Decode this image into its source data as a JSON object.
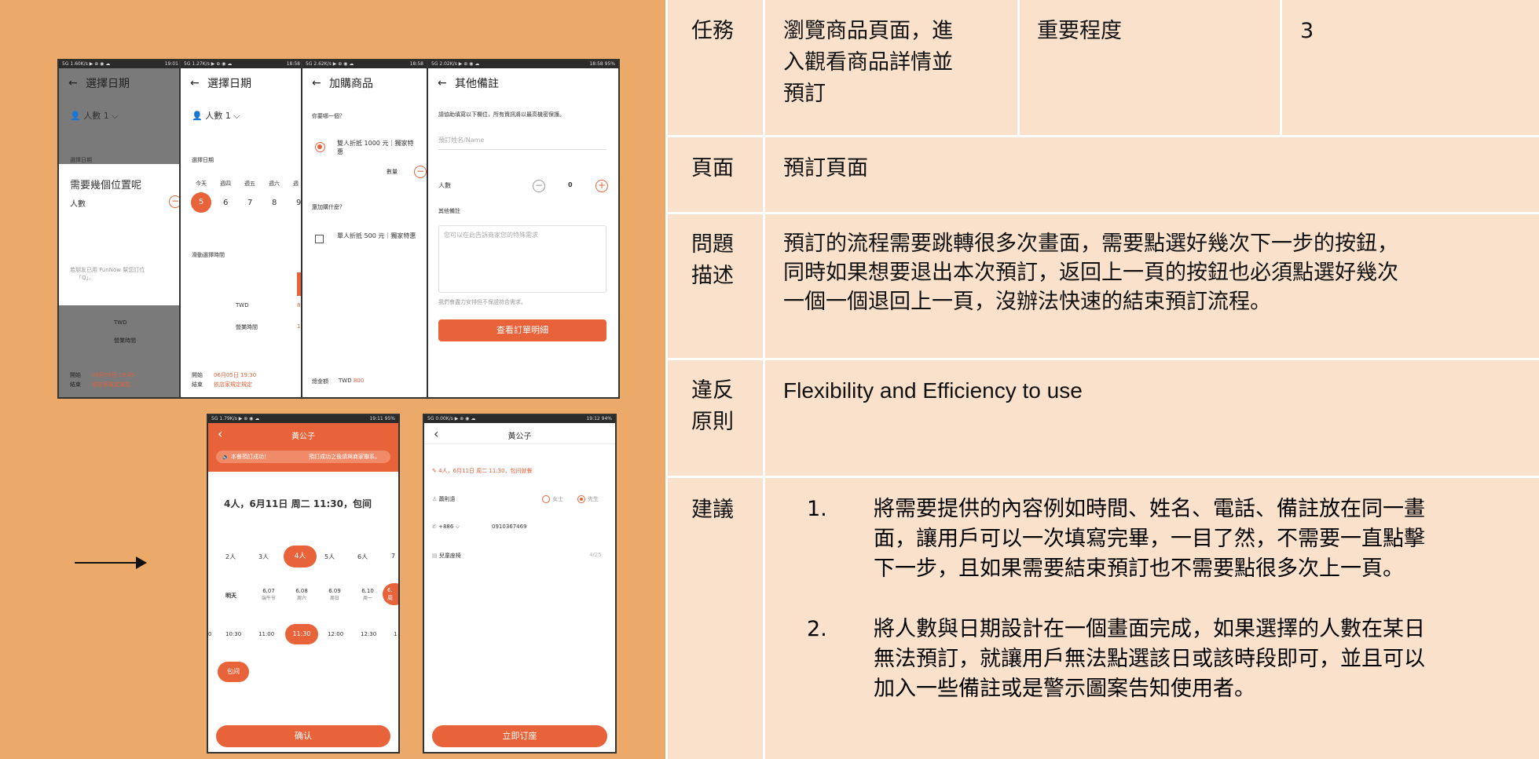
{
  "screens": {
    "s1": {
      "status": "5G 1.60K/s ▶ ⊕ ◉ ☁",
      "time": "19:01",
      "title": "選擇日期",
      "people_label": "人數",
      "people_value": "1",
      "dialog_title": "需要幾個位置呢",
      "dialog_people": "人數",
      "dialog_note": "若朋友已用 FunNow 幫您訂位",
      "dialog_note2": "「Q」。",
      "section_date": "選擇日期",
      "twd": "TWD",
      "business_hours": "營業時間",
      "start_label": "開始",
      "start_value": "06月05日 19:45",
      "end_label": "結束",
      "end_value": "依店家規定規定"
    },
    "s2": {
      "status": "5G 1.27K/s ▶ ⊕ ◉ ☁",
      "time": "18:58",
      "title": "選擇日期",
      "people_label": "人數",
      "people_value": "1",
      "section_date": "選擇日期",
      "days": [
        "今天",
        "週四",
        "週五",
        "週六",
        "週"
      ],
      "dates": [
        "5",
        "6",
        "7",
        "8",
        "9"
      ],
      "section_time": "滑動選擇時間",
      "twd": "TWD",
      "twd_value": "80",
      "business_hours": "營業時間",
      "hours_value": "19",
      "start_label": "開始",
      "start_value": "06月05日 19:30",
      "end_label": "結束",
      "end_value": "依店家規定規定"
    },
    "s3": {
      "status": "5G 2.62K/s ▶ ⊕ ◉ ☁",
      "time": "18:58",
      "title": "加購商品",
      "question1": "你要哪一個？",
      "option1": "雙人折抵 1000 元｜獨家特惠",
      "qty_label": "數量",
      "question2": "還加購什麼？",
      "option2": "單人折抵 500 元｜獨家特惠",
      "total_label": "總金額",
      "total_currency": "TWD",
      "total_value": "800"
    },
    "s4": {
      "status": "5G 2.02K/s ▶ ⊕ ◉ ☁",
      "time": "18:58",
      "battery": "95%",
      "title": "其他備註",
      "instruction": "請協助填寫以下欄位，所有資訊將以最高機密保護。",
      "name_placeholder": "預訂姓名/Name",
      "people_label": "人數",
      "people_count": "0",
      "notes_label": "其他備註",
      "notes_placeholder": "您可以在此告訴商家您的特殊需求",
      "notes_hint": "我們會盡力安排但不保證符合需求。",
      "button": "查看訂單明細"
    },
    "s5": {
      "status": "5G 1.79K/s ▶ ⊕ ◉ ☁",
      "time": "19:11",
      "battery": "95%",
      "title": "黃公子",
      "banner_left": "本餐預訂成功！",
      "banner_right": "預訂成功之後請與商家聯系。",
      "summary": "4人，6月11日 周二 11:30，包间",
      "people": [
        "2人",
        "3人",
        "4人",
        "5人",
        "6人",
        "7"
      ],
      "dates": [
        {
          "top": "明天",
          "bottom": ""
        },
        {
          "top": "6.07",
          "bottom": "端午节"
        },
        {
          "top": "6.08",
          "bottom": "周六"
        },
        {
          "top": "6.09",
          "bottom": "周日"
        },
        {
          "top": "6.10",
          "bottom": "周一"
        },
        {
          "top": "6.",
          "bottom": "周"
        }
      ],
      "times": [
        "0",
        "10:30",
        "11:00",
        "11:30",
        "12:00",
        "12:30",
        "1"
      ],
      "room": "包间",
      "confirm": "确认"
    },
    "s6": {
      "status": "5G 0.00K/s ▶ ⊕ ◉ ☁",
      "time": "19:12",
      "battery": "94%",
      "title": "黃公子",
      "summary": "4人，6月11日 周二 11:30，包间就餐",
      "name": "蕭則遠",
      "gender_f": "女士",
      "gender_m": "先生",
      "phone_code": "+886",
      "phone": "0910367469",
      "seat": "兒童座椅",
      "seat_count": "4/25",
      "button": "立即订座"
    }
  },
  "table": {
    "task_label": "任務",
    "task_value": [
      "瀏覽商品頁面，進",
      "入觀看商品詳情並",
      "預訂"
    ],
    "importance_label": "重要程度",
    "importance_value": "3",
    "page_label": "頁面",
    "page_value": "預訂頁面",
    "problem_label": [
      "問題",
      "描述"
    ],
    "problem_value": [
      "預訂的流程需要跳轉很多次畫面，需要點選好幾次下一步的按鈕，",
      "同時如果想要退出本次預訂，返回上一頁的按鈕也必須點選好幾次",
      "一個一個退回上一頁，沒辦法快速的結束預訂流程。"
    ],
    "principle_label": [
      "違反",
      "原則"
    ],
    "principle_value": "Flexibility and Efficiency to use",
    "suggest_label": "建議",
    "suggestions": [
      {
        "num": "1.",
        "lines": [
          "將需要提供的內容例如時間、姓名、電話、備註放在同一畫",
          "面，讓用戶可以一次填寫完畢，一目了然，不需要一直點擊",
          "下一步，且如果需要結束預訂也不需要點很多次上一頁。"
        ]
      },
      {
        "num": "2.",
        "lines": [
          "將人數與日期設計在一個畫面完成，如果選擇的人數在某日",
          "無法預訂，就讓用戶無法點選該日或該時段即可，並且可以",
          "加入一些備註或是警示圖案告知使用者。"
        ]
      }
    ]
  },
  "colors": {
    "accent": "#e8623a",
    "background": "#ebaa6a",
    "table_bg": "#f9e1cc"
  }
}
